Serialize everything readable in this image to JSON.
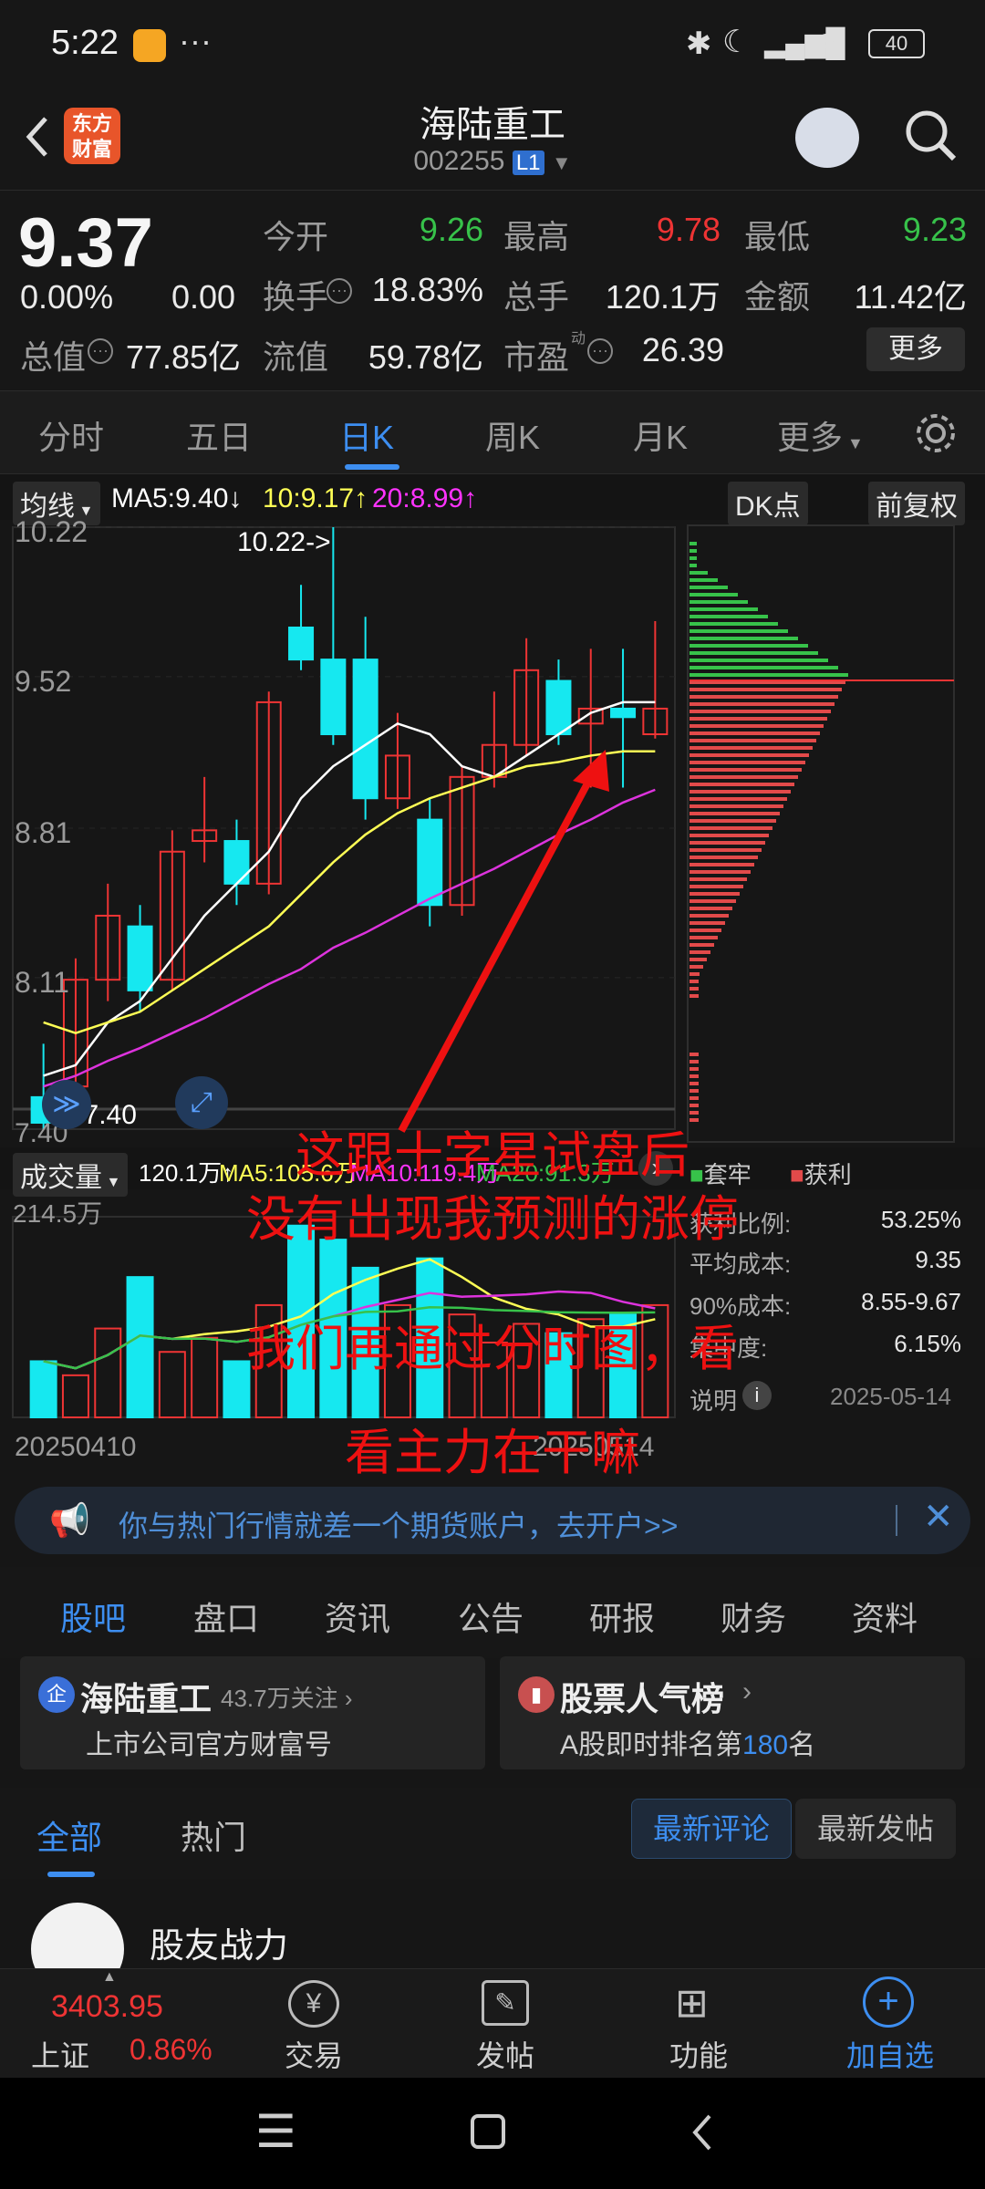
{
  "status": {
    "time": "5:22",
    "dots": "···",
    "battery": "40"
  },
  "header": {
    "logo": "东方财富",
    "title": "海陆重工",
    "code": "002255",
    "level": "L1"
  },
  "quote": {
    "price": "9.37",
    "change_pct": "0.00%",
    "change": "0.00",
    "open_label": "今开",
    "open": "9.26",
    "high_label": "最高",
    "high": "9.78",
    "low_label": "最低",
    "low": "9.23",
    "turnover_label": "换手",
    "turnover": "18.83%",
    "volume_label": "总手",
    "volume": "120.1万",
    "amount_label": "金额",
    "amount": "11.42亿",
    "mcap_label": "总值",
    "mcap": "77.85亿",
    "float_label": "流值",
    "float": "59.78亿",
    "pe_label": "市盈",
    "pe_sup": "动",
    "pe": "26.39",
    "more": "更多"
  },
  "tabs": [
    "分时",
    "五日",
    "日K",
    "周K",
    "月K",
    "更多"
  ],
  "chart_bar": {
    "ma_select": "均线",
    "ma5": "MA5:9.40",
    "ma10": "10:9.17",
    "ma20": "20:8.99",
    "dk": "DK点",
    "adjust": "前复权"
  },
  "axis": {
    "y1": "10.22",
    "y2": "9.52",
    "y3": "8.81",
    "y4": "8.11",
    "y5": "7.40",
    "high_mark": "10.22->",
    "low_mark": "<-7.40"
  },
  "vol_bar": {
    "label": "成交量",
    "v": "120.1万",
    "ma5": "MA5:105.6万",
    "ma10": "MA10:119.4万",
    "ma20": "MA20:91.3万",
    "vmax": "214.5万",
    "date_left": "20250410",
    "date_right": "20250514"
  },
  "chip": {
    "legend_trapped": "套牢",
    "legend_profit": "获利",
    "rows": [
      {
        "k": "获利比例:",
        "v": "53.25%"
      },
      {
        "k": "平均成本:",
        "v": "9.35"
      },
      {
        "k": "90%成本:",
        "v": "8.55-9.67"
      },
      {
        "k": "集中度:",
        "v": "6.15%"
      }
    ],
    "note": "说明",
    "date": "2025-05-14"
  },
  "overlay": {
    "line1": "这跟十字星试盘后",
    "line2": "没有出现我预测的涨停",
    "line3": "我们再通过分时图，看",
    "line4": "看主力在干嘛"
  },
  "ad": {
    "text": "你与热门行情就差一个期货账户，去开户>>"
  },
  "subtabs": [
    "股吧",
    "盘口",
    "资讯",
    "公告",
    "研报",
    "财务",
    "资料"
  ],
  "cards": {
    "left_title": "海陆重工",
    "left_follow": "43.7万关注",
    "left_sub": "上市公司官方财富号",
    "right_title": "股票人气榜",
    "right_sub_pre": "A股即时排名第",
    "right_rank": "180",
    "right_sub_post": "名"
  },
  "filter": {
    "all": "全部",
    "hot": "热门",
    "latest_comment": "最新评论",
    "latest_post": "最新发帖"
  },
  "post": {
    "author": "股友战力"
  },
  "bottom": {
    "index_value": "3403.95",
    "index_name": "上证",
    "index_pct": "0.86%",
    "trade": "交易",
    "post": "发帖",
    "func": "功能",
    "add": "加自选"
  },
  "chart_data": {
    "type": "candlestick",
    "ylim": [
      7.4,
      10.22
    ],
    "candles": [
      {
        "o": 7.55,
        "c": 7.43,
        "h": 7.8,
        "l": 7.4
      },
      {
        "o": 7.6,
        "c": 8.1,
        "h": 8.2,
        "l": 7.55
      },
      {
        "o": 8.1,
        "c": 8.4,
        "h": 8.55,
        "l": 8.0
      },
      {
        "o": 8.35,
        "c": 8.05,
        "h": 8.45,
        "l": 7.95
      },
      {
        "o": 8.1,
        "c": 8.7,
        "h": 8.8,
        "l": 8.05
      },
      {
        "o": 8.75,
        "c": 8.8,
        "h": 9.05,
        "l": 8.65
      },
      {
        "o": 8.75,
        "c": 8.55,
        "h": 8.85,
        "l": 8.45
      },
      {
        "o": 8.55,
        "c": 9.4,
        "h": 9.45,
        "l": 8.5
      },
      {
        "o": 9.75,
        "c": 9.6,
        "h": 9.95,
        "l": 9.55
      },
      {
        "o": 9.6,
        "c": 9.25,
        "h": 10.22,
        "l": 9.2
      },
      {
        "o": 9.6,
        "c": 8.95,
        "h": 9.8,
        "l": 8.85
      },
      {
        "o": 8.95,
        "c": 9.15,
        "h": 9.35,
        "l": 8.9
      },
      {
        "o": 8.85,
        "c": 8.45,
        "h": 8.95,
        "l": 8.35
      },
      {
        "o": 8.45,
        "c": 9.05,
        "h": 9.1,
        "l": 8.4
      },
      {
        "o": 9.05,
        "c": 9.2,
        "h": 9.45,
        "l": 9.0
      },
      {
        "o": 9.2,
        "c": 9.55,
        "h": 9.7,
        "l": 9.15
      },
      {
        "o": 9.5,
        "c": 9.25,
        "h": 9.6,
        "l": 9.2
      },
      {
        "o": 9.3,
        "c": 9.37,
        "h": 9.65,
        "l": 9.0
      },
      {
        "o": 9.37,
        "c": 9.33,
        "h": 9.65,
        "l": 9.0
      },
      {
        "o": 9.25,
        "c": 9.37,
        "h": 9.78,
        "l": 9.23
      }
    ],
    "ma5": [
      7.65,
      7.7,
      7.9,
      8.0,
      8.2,
      8.4,
      8.55,
      8.7,
      8.95,
      9.1,
      9.2,
      9.3,
      9.25,
      9.1,
      9.05,
      9.15,
      9.25,
      9.35,
      9.4,
      9.4
    ],
    "ma10": [
      7.9,
      7.85,
      7.9,
      7.95,
      8.05,
      8.15,
      8.25,
      8.35,
      8.5,
      8.65,
      8.78,
      8.88,
      8.95,
      9.0,
      9.05,
      9.1,
      9.12,
      9.15,
      9.17,
      9.17
    ],
    "ma20": [
      7.6,
      7.65,
      7.72,
      7.78,
      7.85,
      7.92,
      8.0,
      8.08,
      8.15,
      8.25,
      8.32,
      8.4,
      8.48,
      8.55,
      8.62,
      8.7,
      8.78,
      8.85,
      8.93,
      8.99
    ],
    "volume": [
      60,
      45,
      95,
      150,
      70,
      85,
      60,
      120,
      205,
      190,
      160,
      120,
      170,
      110,
      80,
      100,
      90,
      105,
      110,
      120
    ],
    "volume_up": [
      false,
      true,
      true,
      false,
      true,
      true,
      false,
      true,
      false,
      false,
      false,
      true,
      false,
      true,
      true,
      true,
      false,
      true,
      false,
      true
    ]
  }
}
